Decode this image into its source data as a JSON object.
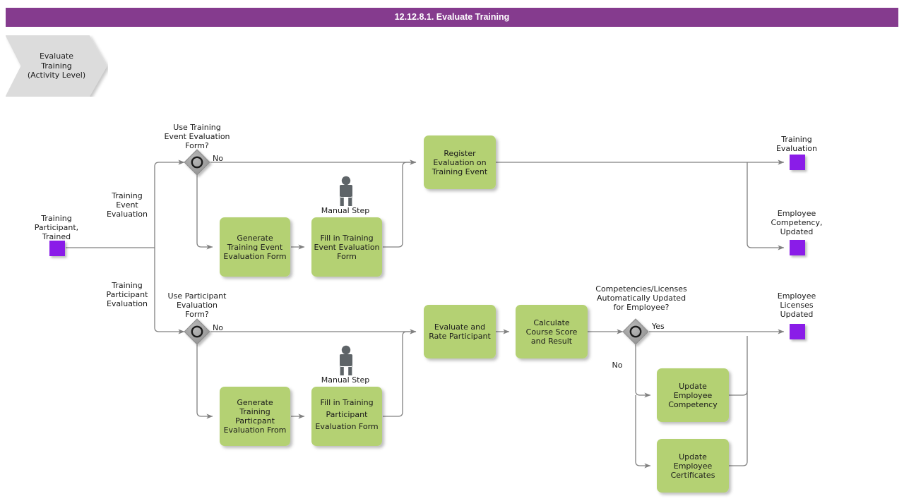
{
  "window": {
    "title": "12.12.8.1. Evaluate Training"
  },
  "banner": {
    "line1": "Evaluate",
    "line2": "Training",
    "line3": "(Activity Level)"
  },
  "colors": {
    "title_bar": "#853b8e",
    "task": "#b4d173",
    "data_object": "#8a1fe8",
    "gateway": "#9b9b9b",
    "line": "#808080",
    "banner": "#dcdcdc"
  },
  "data_objects": [
    {
      "id": "training-participant-trained",
      "label_lines": [
        "Training",
        "Participant,",
        "Trained"
      ]
    },
    {
      "id": "training-evaluation",
      "label_lines": [
        "Training",
        "Evaluation"
      ]
    },
    {
      "id": "employee-competency-updated",
      "label_lines": [
        "Employee",
        "Competency,",
        "Updated"
      ]
    },
    {
      "id": "employee-licenses-updated",
      "label_lines": [
        "Employee",
        "Licenses",
        "Updated"
      ]
    }
  ],
  "gateways": [
    {
      "id": "use-training-event-evaluation-form",
      "label_lines": [
        "Use Training",
        "Event Evaluation",
        "Form?"
      ],
      "branch_label": "No"
    },
    {
      "id": "use-participant-evaluation-form",
      "label_lines": [
        "Use Participant",
        "Evaluation",
        "Form?"
      ],
      "branch_label": "No"
    },
    {
      "id": "competencies-licenses-auto-updated",
      "label_lines": [
        "Competencies/Licenses",
        "Automatically Updated",
        "for Employee?"
      ],
      "branch_label_yes": "Yes",
      "branch_label_no": "No"
    }
  ],
  "edge_labels": {
    "training_event_evaluation": [
      "Training",
      "Event",
      "Evaluation"
    ],
    "training_participant_evaluation": [
      "Training",
      "Participant",
      "Evaluation"
    ]
  },
  "manual_step_labels": {
    "top": "Manual Step",
    "bottom": "Manual Step"
  },
  "tasks": [
    {
      "id": "generate-training-event-evaluation-form",
      "label_lines": [
        "Generate",
        "Training Event",
        "Evaluation Form"
      ]
    },
    {
      "id": "fill-in-training-event-evaluation-form",
      "label_lines": [
        "Fill in Training",
        "Event Evaluation",
        "Form"
      ]
    },
    {
      "id": "register-evaluation-on-training-event",
      "label_lines": [
        "Register",
        "Evaluation on",
        "Training Event"
      ]
    },
    {
      "id": "generate-training-participant-evaluation-from",
      "label_lines": [
        "Generate",
        "Training",
        "Particpant",
        "Evaluation From"
      ]
    },
    {
      "id": "fill-in-training-participant-evaluation-form",
      "label_lines": [
        "Fill in Training",
        "Participant",
        "Evaluation Form"
      ]
    },
    {
      "id": "evaluate-and-rate-participant",
      "label_lines": [
        "Evaluate and",
        "Rate Participant"
      ]
    },
    {
      "id": "calculate-course-score-and-result",
      "label_lines": [
        "Calculate",
        "Course Score",
        "and Result"
      ]
    },
    {
      "id": "update-employee-competency",
      "label_lines": [
        "Update",
        "Employee",
        "Competency"
      ]
    },
    {
      "id": "update-employee-certificates",
      "label_lines": [
        "Update",
        "Employee",
        "Certificates"
      ]
    }
  ]
}
